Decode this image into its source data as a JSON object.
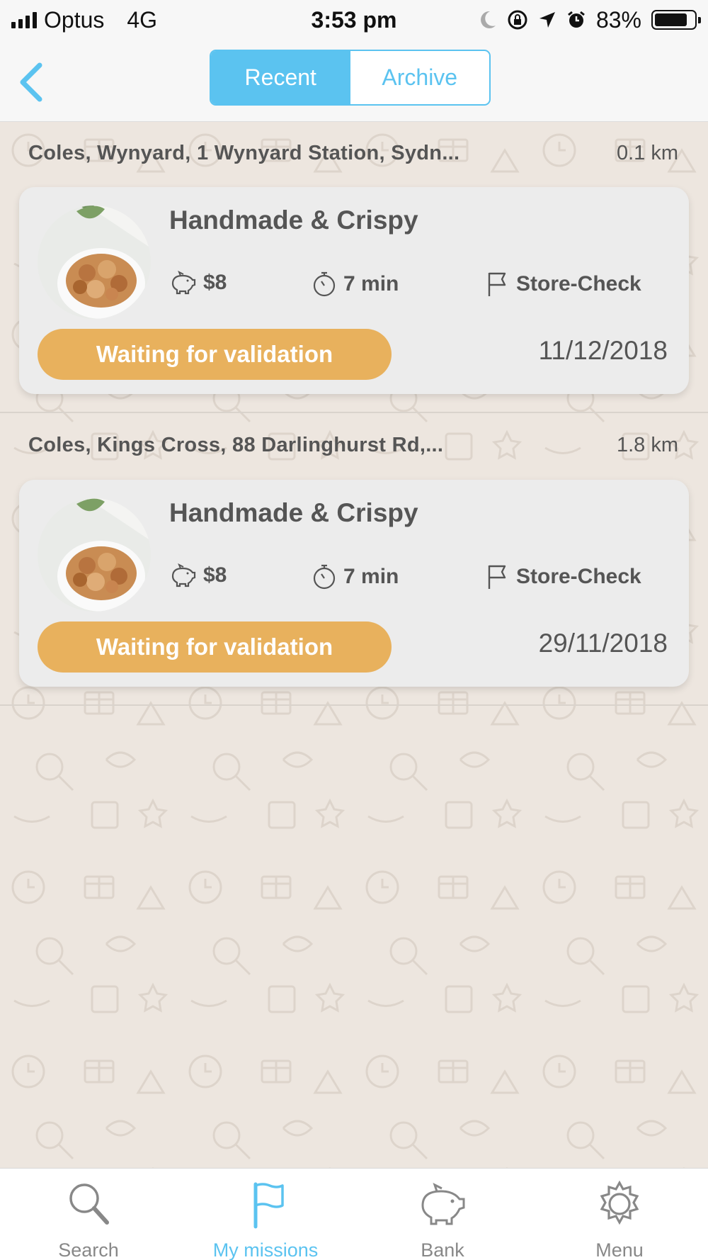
{
  "status_bar": {
    "carrier": "Optus",
    "network": "4G",
    "time": "3:53 pm",
    "battery": "83%",
    "battery_level": 0.83
  },
  "nav": {
    "segments": [
      {
        "label": "Recent",
        "active": true
      },
      {
        "label": "Archive",
        "active": false
      }
    ]
  },
  "missions": [
    {
      "store": "Coles, Wynyard, 1 Wynyard Station, Sydn...",
      "distance": "0.1 km",
      "title": "Handmade & Crispy",
      "reward": "$8",
      "duration": "7 min",
      "type": "Store-Check",
      "status": "Waiting for validation",
      "date": "11/12/2018"
    },
    {
      "store": "Coles, Kings Cross, 88 Darlinghurst Rd,...",
      "distance": "1.8 km",
      "title": "Handmade & Crispy",
      "reward": "$8",
      "duration": "7 min",
      "type": "Store-Check",
      "status": "Waiting for validation",
      "date": "29/11/2018"
    }
  ],
  "tabs": [
    {
      "label": "Search",
      "icon": "search-icon",
      "active": false
    },
    {
      "label": "My missions",
      "icon": "flag-icon",
      "active": true
    },
    {
      "label": "Bank",
      "icon": "piggy-bank-icon",
      "active": false
    },
    {
      "label": "Menu",
      "icon": "gear-icon",
      "active": false
    }
  ],
  "colors": {
    "accent": "#5bc3f0",
    "status_pending": "#e8b15d",
    "background": "#ede6df"
  }
}
